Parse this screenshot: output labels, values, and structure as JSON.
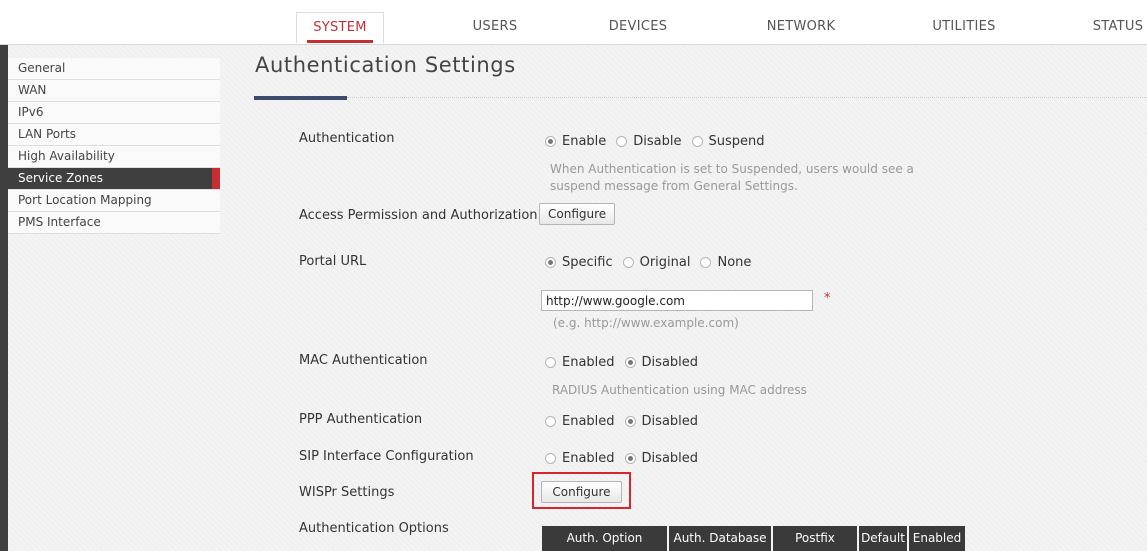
{
  "nav": {
    "tabs": [
      {
        "label": "SYSTEM",
        "active": true
      },
      {
        "label": "USERS",
        "active": false
      },
      {
        "label": "DEVICES",
        "active": false
      },
      {
        "label": "NETWORK",
        "active": false
      },
      {
        "label": "UTILITIES",
        "active": false
      },
      {
        "label": "STATUS",
        "active": false
      }
    ]
  },
  "sidebar": {
    "items": [
      {
        "label": "General",
        "active": false
      },
      {
        "label": "WAN",
        "active": false
      },
      {
        "label": "IPv6",
        "active": false
      },
      {
        "label": "LAN Ports",
        "active": false
      },
      {
        "label": "High Availability",
        "active": false
      },
      {
        "label": "Service Zones",
        "active": true
      },
      {
        "label": "Port Location Mapping",
        "active": false
      },
      {
        "label": "PMS Interface",
        "active": false
      }
    ]
  },
  "page": {
    "title": "Authentication Settings"
  },
  "form": {
    "authentication": {
      "label": "Authentication",
      "options": [
        "Enable",
        "Disable",
        "Suspend"
      ],
      "selected": "Enable",
      "hint_line1": "When Authentication is set to Suspended, users would see a",
      "hint_line2": "suspend message from General Settings."
    },
    "access_permission": {
      "label": "Access Permission and Authorization",
      "button": "Configure"
    },
    "portal_url": {
      "label": "Portal URL",
      "options": [
        "Specific",
        "Original",
        "None"
      ],
      "selected": "Specific",
      "value": "http://www.google.com",
      "required_mark": "*",
      "example": "(e.g. http://www.example.com)"
    },
    "mac_auth": {
      "label": "MAC Authentication",
      "options": [
        "Enabled",
        "Disabled"
      ],
      "selected": "Disabled",
      "hint": "RADIUS Authentication using MAC address"
    },
    "ppp_auth": {
      "label": "PPP Authentication",
      "options": [
        "Enabled",
        "Disabled"
      ],
      "selected": "Disabled"
    },
    "sip_config": {
      "label": "SIP Interface Configuration",
      "options": [
        "Enabled",
        "Disabled"
      ],
      "selected": "Disabled"
    },
    "wispr": {
      "label": "WISPr Settings",
      "button": "Configure"
    },
    "auth_options": {
      "label": "Authentication Options",
      "columns": [
        "Auth. Option",
        "Auth. Database",
        "Postfix",
        "Default",
        "Enabled"
      ]
    }
  },
  "colors": {
    "accent": "#c62e34",
    "sidebar_dark": "#3f3f3f",
    "title_underline": "#3d4a6b"
  }
}
